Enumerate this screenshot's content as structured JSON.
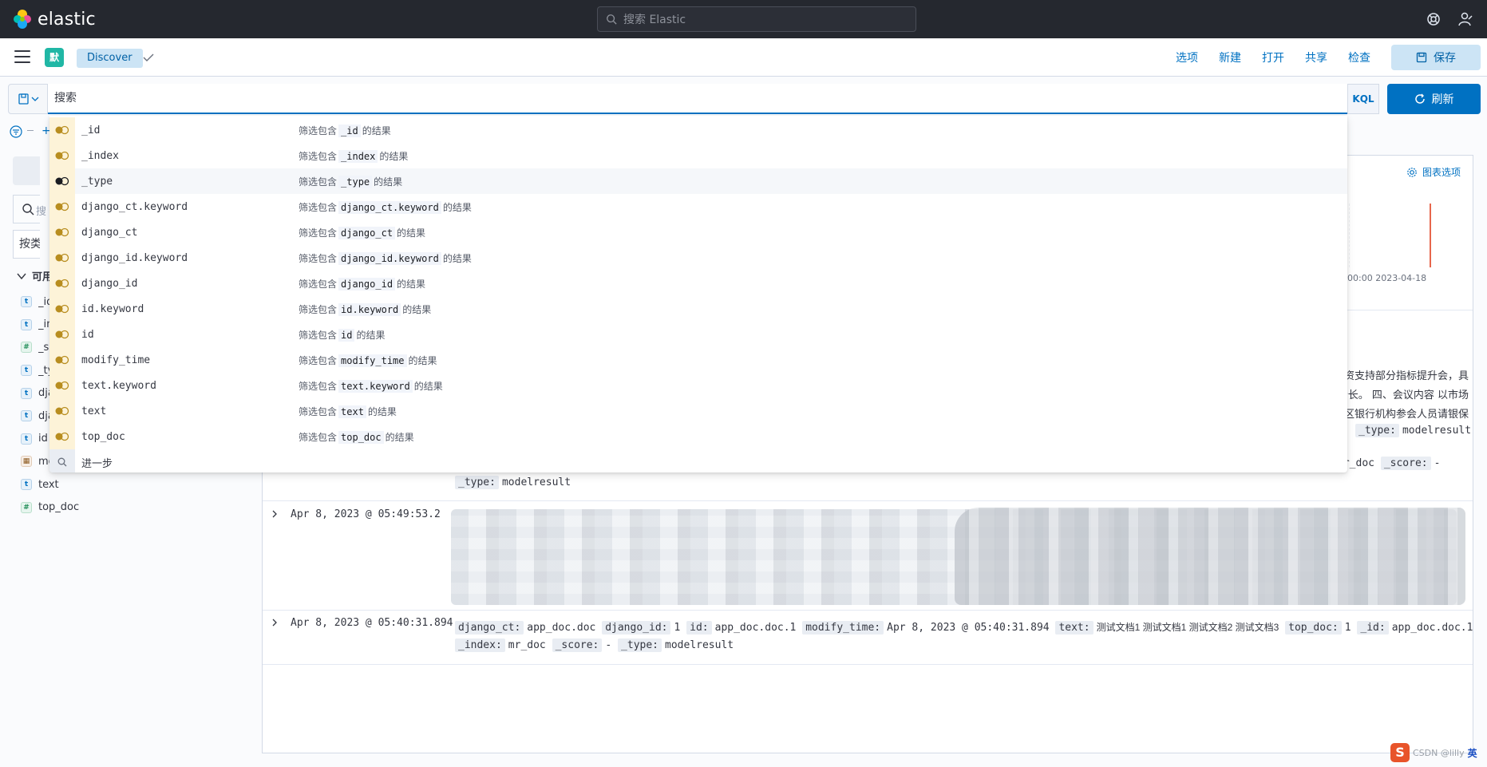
{
  "header": {
    "logo_text": "elastic",
    "search_placeholder": "搜索 Elastic"
  },
  "appbar": {
    "space_initial": "默",
    "breadcrumb": "Discover",
    "nav": [
      "选项",
      "新建",
      "打开",
      "共享",
      "检查"
    ],
    "save_label": "保存"
  },
  "query": {
    "placeholder": "搜索",
    "language": "KQL",
    "refresh_label": "刷新"
  },
  "sidebar": {
    "search_fragment": "搜",
    "type_filter_fragment": "按类型",
    "available_fragment": "可用",
    "fields": [
      {
        "type": "t",
        "name": "_id"
      },
      {
        "type": "t",
        "name": "_index"
      },
      {
        "type": "#",
        "name": "_score"
      },
      {
        "type": "t",
        "name": "_type"
      },
      {
        "type": "t",
        "name": "django_ct"
      },
      {
        "type": "t",
        "name": "django_id"
      },
      {
        "type": "t",
        "name": "id"
      },
      {
        "type": "date",
        "name": "modify_time"
      },
      {
        "type": "t",
        "name": "text"
      },
      {
        "type": "#",
        "name": "top_doc"
      }
    ]
  },
  "chart": {
    "options_label": "图表选项",
    "axis_label_fragment": "2023-04-18 00:00"
  },
  "suggestions": {
    "prefix": "筛选包含",
    "suffix": "的结果",
    "items": [
      "_id",
      "_index",
      "_type",
      "django_ct.keyword",
      "django_ct",
      "django_id.keyword",
      "django_id",
      "id.keyword",
      "id",
      "modify_time",
      "text.keyword",
      "text",
      "top_doc"
    ],
    "active_index": 2,
    "more_label": "进一步"
  },
  "documents": {
    "frag_line1": "融资支持部分指标提升会，具",
    "frag_line2": "行长。 四、会议内容 以市场",
    "frag_line3": "区银行机构参会人员请银保",
    "frag_type_label": "_type:",
    "frag_type_value": "modelresult",
    "row1_index_frag": "mr_doc",
    "row1_score_label": "_score:",
    "row1_score_value": "-",
    "row1_type_label": "_type:",
    "row1_type_value": "modelresult",
    "row2_time": "Apr 8, 2023 @ 05:49:53.2",
    "row3_time": "Apr 8, 2023 @ 05:40:31.894",
    "row3_fields": [
      {
        "k": "django_ct:",
        "v": "app_doc.doc"
      },
      {
        "k": "django_id:",
        "v": "1"
      },
      {
        "k": "id:",
        "v": "app_doc.doc.1"
      },
      {
        "k": "modify_time:",
        "v": "Apr 8, 2023 @ 05:40:31.894"
      },
      {
        "k": "text:",
        "v": "测试文档1 测试文档1 测试文档2 测试文档3"
      },
      {
        "k": "top_doc:",
        "v": "1"
      },
      {
        "k": "_id:",
        "v": "app_doc.doc.1"
      }
    ],
    "row3_fields_2": [
      {
        "k": "_index:",
        "v": "mr_doc"
      },
      {
        "k": "_score:",
        "v": "-"
      },
      {
        "k": "_type:",
        "v": "modelresult"
      }
    ]
  },
  "watermark": {
    "logo": "S",
    "text": "CSDN @lilly",
    "ime": "英"
  }
}
